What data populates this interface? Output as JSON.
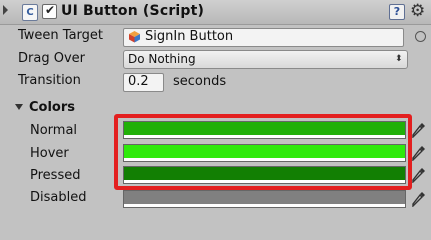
{
  "header": {
    "title": "UI Button (Script)",
    "enabled": true,
    "checkmark": "✔",
    "script_icon_glyph": "C",
    "help_glyph": "?",
    "gear_glyph": "⚙"
  },
  "fields": {
    "tween_target": {
      "label": "Tween Target",
      "value": "SignIn Button"
    },
    "drag_over": {
      "label": "Drag Over",
      "value": "Do Nothing",
      "arrow": "⬍"
    },
    "transition": {
      "label": "Transition",
      "value": "0.2",
      "unit": "seconds"
    }
  },
  "colors": {
    "label": "Colors",
    "items": [
      {
        "label": "Normal",
        "color": "#21b008"
      },
      {
        "label": "Hover",
        "color": "#2fea0c"
      },
      {
        "label": "Pressed",
        "color": "#127f03"
      },
      {
        "label": "Disabled",
        "color": "#808080"
      }
    ]
  },
  "highlight_color": "#e31f1f"
}
